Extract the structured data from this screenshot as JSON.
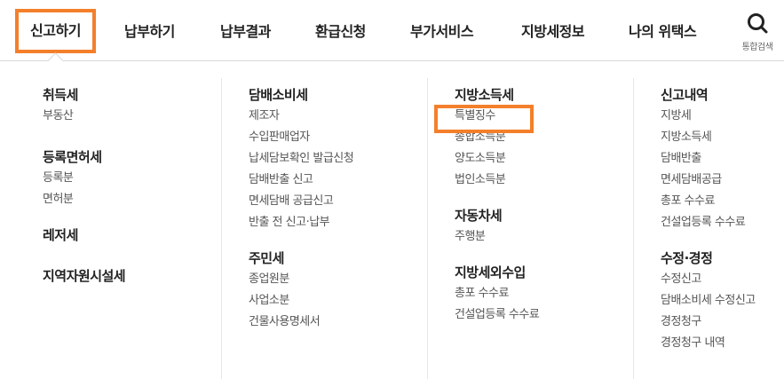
{
  "nav": {
    "items": [
      "신고하기",
      "납부하기",
      "납부결과",
      "환급신청",
      "부가서비스",
      "지방세정보",
      "나의 위택스"
    ],
    "search_label": "통합검색"
  },
  "menu": {
    "col1": {
      "acquisition": {
        "title": "취득세",
        "items": [
          "부동산"
        ]
      },
      "registration": {
        "title": "등록면허세",
        "items": [
          "등록분",
          "면허분"
        ]
      },
      "leisure": {
        "title": "레저세",
        "items": []
      },
      "regional": {
        "title": "지역자원시설세",
        "items": []
      }
    },
    "col2": {
      "tobacco": {
        "title": "담배소비세",
        "items": [
          "제조자",
          "수입판매업자",
          "납세담보확인 발급신청",
          "담배반출 신고",
          "면세담배 공급신고",
          "반출 전 신고·납부"
        ]
      },
      "resident": {
        "title": "주민세",
        "items": [
          "종업원분",
          "사업소분",
          "건물사용명세서"
        ]
      }
    },
    "col3": {
      "local_income": {
        "title": "지방소득세",
        "items": [
          "특별징수",
          "종합소득분",
          "양도소득분",
          "법인소득분"
        ]
      },
      "vehicle": {
        "title": "자동차세",
        "items": [
          "주행분"
        ]
      },
      "non_tax": {
        "title": "지방세외수입",
        "items": [
          "총포 수수료",
          "건설업등록 수수료"
        ]
      }
    },
    "col4": {
      "history": {
        "title": "신고내역",
        "items": [
          "지방세",
          "지방소득세",
          "담배반출",
          "면세담배공급",
          "총포 수수료",
          "건설업등록 수수료"
        ]
      },
      "amend": {
        "title": "수정·경정",
        "items": [
          "수정신고",
          "담배소비세 수정신고",
          "경정청구",
          "경정청구 내역"
        ]
      }
    }
  },
  "colors": {
    "accent": "#f47f2b",
    "text": "#222222",
    "subtext": "#555555",
    "divider": "#e6e6e6"
  }
}
